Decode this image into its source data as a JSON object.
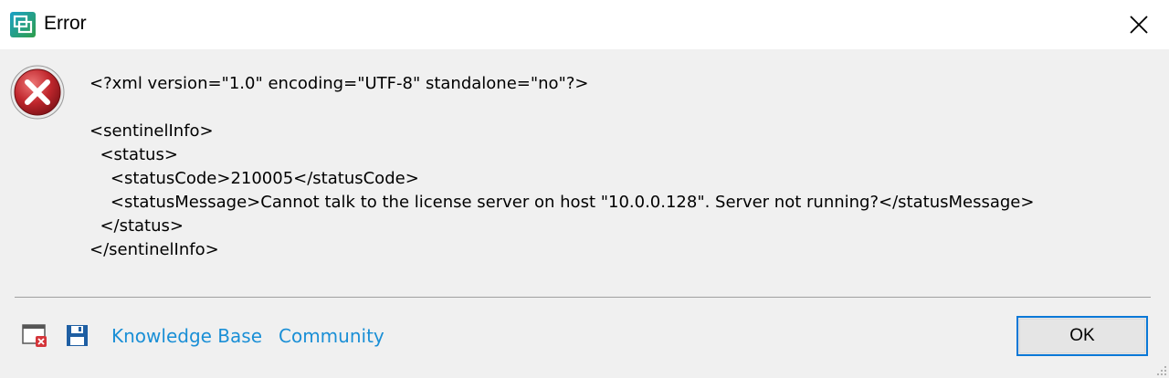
{
  "window": {
    "title": "Error",
    "close_icon": "close-icon",
    "app_icon": "app-icon"
  },
  "dialog": {
    "icon": "error-icon",
    "message_lines": [
      "<?xml version=\"1.0\" encoding=\"UTF-8\" standalone=\"no\"?>",
      "",
      "<sentinelInfo>",
      "  <status>",
      "    <statusCode>210005</statusCode>",
      "    <statusMessage>Cannot talk to the license server on host \"10.0.0.128\". Server not running?</statusMessage>",
      "  </status>",
      "</sentinelInfo>"
    ]
  },
  "footer": {
    "details_icon": "window-error-icon",
    "save_icon": "save-icon",
    "links": {
      "knowledge_base": "Knowledge Base",
      "community": "Community"
    },
    "ok_label": "OK"
  },
  "colors": {
    "link": "#1a8fd6",
    "ok_border": "#0a78d7",
    "error_red": "#c0272d",
    "background": "#f0f0f0"
  }
}
